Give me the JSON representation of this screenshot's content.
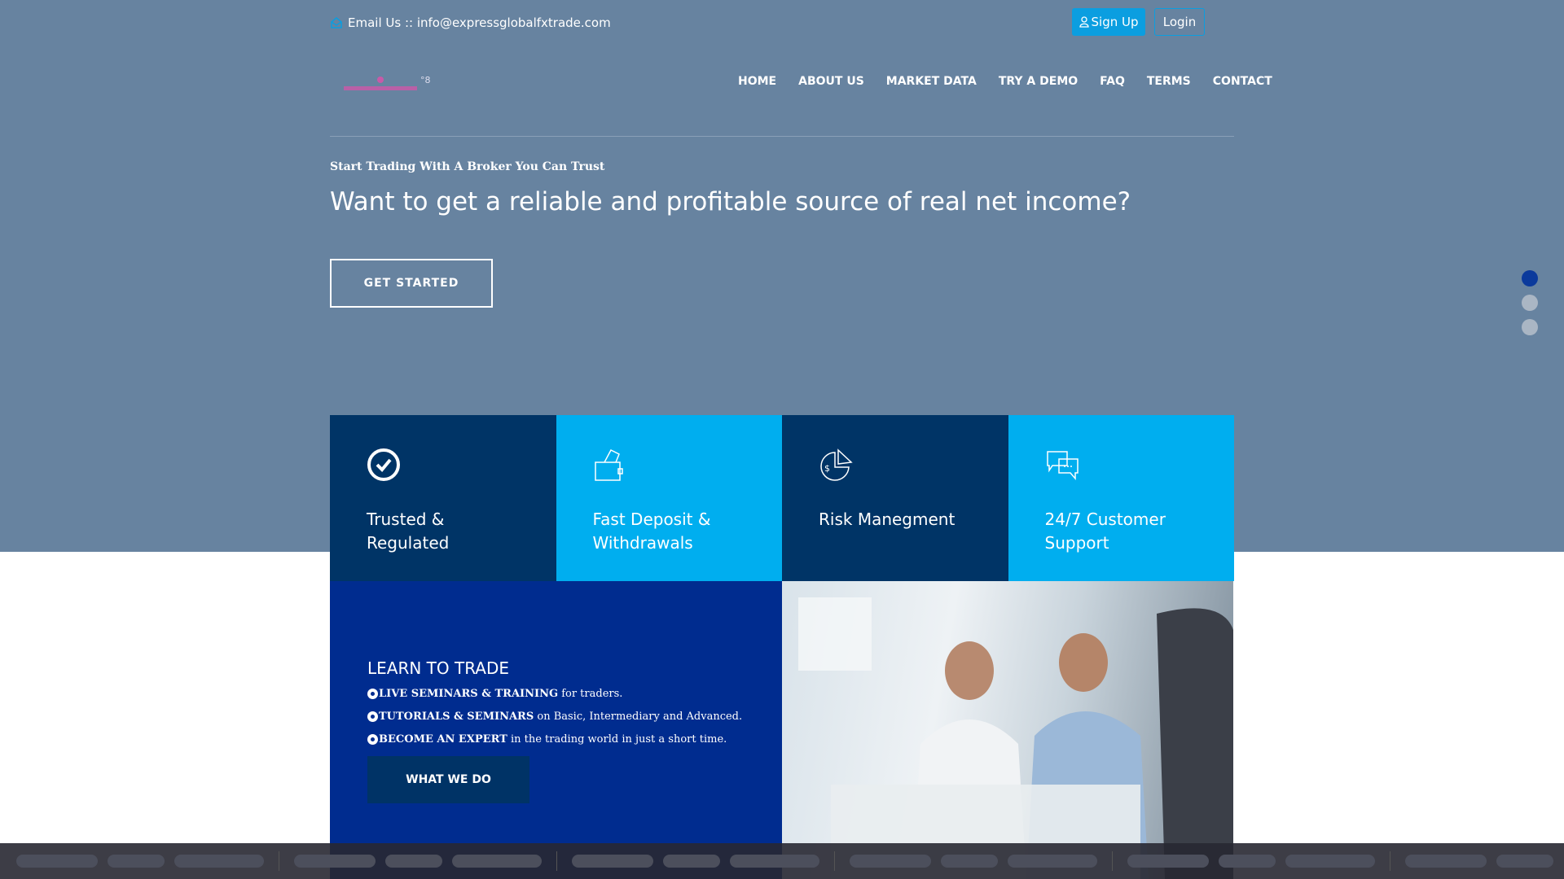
{
  "topbar": {
    "email_label": "Email Us :: info@expressglobalfxtrade.com",
    "signup": "Sign Up",
    "login": "Login"
  },
  "nav": [
    "HOME",
    "ABOUT US",
    "MARKET DATA",
    "TRY A DEMO",
    "FAQ",
    "TERMS",
    "CONTACT"
  ],
  "hero": {
    "tagline": "Start Trading With A Broker You Can Trust",
    "headline": "Want to get a reliable and profitable source of real net income?",
    "cta": "GET STARTED",
    "slide_active": 1,
    "slide_count": 3
  },
  "features": [
    {
      "icon": "check-circle-icon",
      "label": "Trusted & Regulated"
    },
    {
      "icon": "wallet-icon",
      "label": "Fast Deposit & Withdrawals"
    },
    {
      "icon": "pie-chart-dollar-icon",
      "label": "Risk Manegment"
    },
    {
      "icon": "chat-bubbles-icon",
      "label": "24/7 Customer Support"
    }
  ],
  "learn": {
    "title": "LEARN TO TRADE",
    "bullets": [
      {
        "bold": "LIVE SEMINARS & TRAINING",
        "rest": " for traders."
      },
      {
        "bold": "TUTORIALS & SEMINARS",
        "rest": " on Basic, Intermediary and Advanced."
      },
      {
        "bold": "BECOME AN EXPERT",
        "rest": " in the trading world in just a short time."
      }
    ],
    "button": "WHAT WE DO"
  },
  "colors": {
    "hero_bg": "#6783a0",
    "dark": "#003466",
    "light": "#00aeef",
    "learn_bg": "#002c8f",
    "accent": "#0b9ee0"
  }
}
